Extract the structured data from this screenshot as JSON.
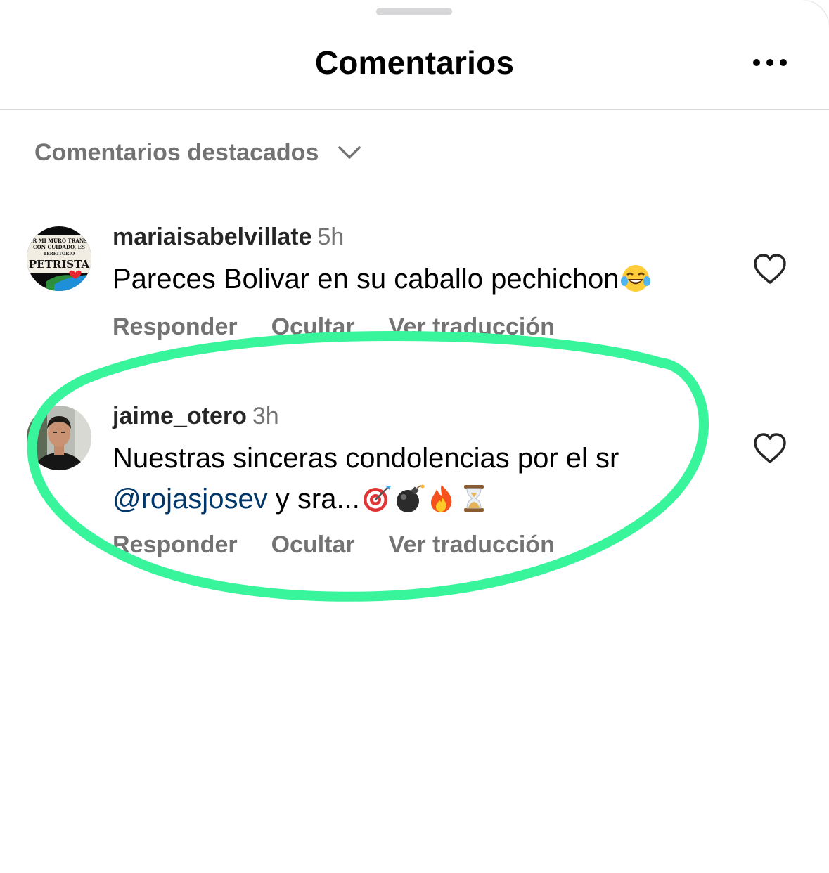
{
  "header": {
    "title": "Comentarios",
    "more_icon": "more-horizontal-icon"
  },
  "filter": {
    "label": "Comentarios destacados",
    "icon": "chevron-down-icon"
  },
  "comments": [
    {
      "username": "mariaisabelvillate",
      "time": "5h",
      "text": "Pareces Bolivar en su caballo pechichon",
      "emojis": [
        "😂"
      ],
      "avatar_text": [
        "OR MI MURO TRANSI",
        "CON CUIDADO, ES",
        "TERRITORIO",
        "PETRISTA"
      ],
      "actions": [
        "Responder",
        "Ocultar",
        "Ver traducción"
      ],
      "like_icon": "heart-outline-icon"
    },
    {
      "username": "jaime_otero",
      "time": "3h",
      "text_line1": "Nuestras sinceras condolencias por el sr",
      "mention": "@rojasjosev",
      "text_line2": " y sra...",
      "emojis": [
        "🎯",
        "💣",
        "🔥",
        "⌛"
      ],
      "actions": [
        "Responder",
        "Ocultar",
        "Ver traducción"
      ],
      "like_icon": "heart-outline-icon"
    }
  ],
  "colors": {
    "highlight": "#38f59c",
    "secondary_text": "#737373",
    "mention": "#00376b",
    "divider": "#dbdbdb"
  }
}
